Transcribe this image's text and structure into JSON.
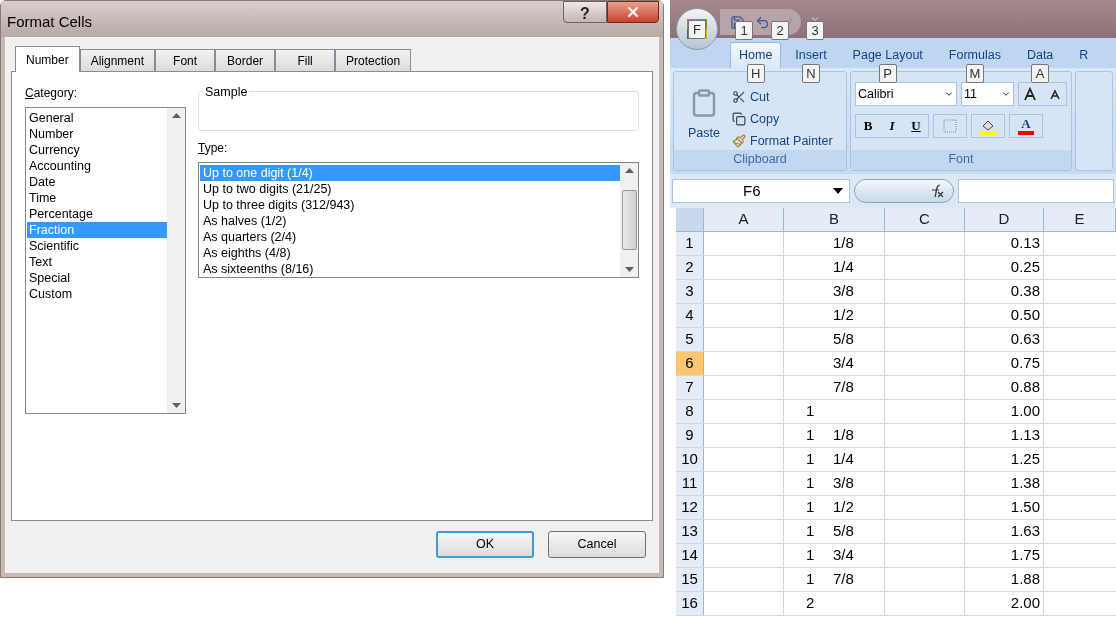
{
  "dialog": {
    "title": "Format Cells",
    "help": "?",
    "tabs": [
      {
        "label": "Number",
        "selected": true
      },
      {
        "label": "Alignment",
        "selected": false
      },
      {
        "label": "Font",
        "selected": false
      },
      {
        "label": "Border",
        "selected": false
      },
      {
        "label": "Fill",
        "selected": false
      },
      {
        "label": "Protection",
        "selected": false
      }
    ],
    "category_label": "Category:",
    "categories": [
      {
        "label": "General",
        "selected": false
      },
      {
        "label": "Number",
        "selected": false
      },
      {
        "label": "Currency",
        "selected": false
      },
      {
        "label": "Accounting",
        "selected": false
      },
      {
        "label": "Date",
        "selected": false
      },
      {
        "label": "Time",
        "selected": false
      },
      {
        "label": "Percentage",
        "selected": false
      },
      {
        "label": "Fraction",
        "selected": true
      },
      {
        "label": "Scientific",
        "selected": false
      },
      {
        "label": "Text",
        "selected": false
      },
      {
        "label": "Special",
        "selected": false
      },
      {
        "label": "Custom",
        "selected": false
      }
    ],
    "sample_label": "Sample",
    "type_label": "Type:",
    "types": [
      {
        "label": "Up to one digit (1/4)",
        "selected": true
      },
      {
        "label": "Up to two digits (21/25)",
        "selected": false
      },
      {
        "label": "Up to three digits (312/943)",
        "selected": false
      },
      {
        "label": "As halves (1/2)",
        "selected": false
      },
      {
        "label": "As quarters (2/4)",
        "selected": false
      },
      {
        "label": "As eighths (4/8)",
        "selected": false
      },
      {
        "label": "As sixteenths (8/16)",
        "selected": false
      }
    ],
    "buttons": [
      {
        "label": "OK",
        "default": true
      },
      {
        "label": "Cancel",
        "default": false
      }
    ]
  },
  "excel": {
    "office_keytip": "F",
    "quick_access_keytips": [
      "1",
      "2",
      "3"
    ],
    "ribbon_tabs": [
      {
        "label": "Home",
        "selected": true,
        "keytip": "H"
      },
      {
        "label": "Insert",
        "selected": false,
        "keytip": "N"
      },
      {
        "label": "Page Layout",
        "selected": false,
        "keytip": "P"
      },
      {
        "label": "Formulas",
        "selected": false,
        "keytip": "M"
      },
      {
        "label": "Data",
        "selected": false,
        "keytip": "A"
      },
      {
        "label": "R",
        "selected": false
      }
    ],
    "clipboard": {
      "paste": "Paste",
      "cut": "Cut",
      "copy": "Copy",
      "format_painter": "Format Painter",
      "label": "Clipboard"
    },
    "font": {
      "name": "Calibri",
      "size": "11",
      "bold": "B",
      "italic": "I",
      "underline": "U",
      "font_color": "A",
      "label": "Font"
    },
    "name_box": "F6",
    "columns": [
      "A",
      "B",
      "C",
      "D",
      "E"
    ],
    "rows": [
      {
        "number": "1",
        "selected": false,
        "b": {
          "fraction": "1/8"
        },
        "d": "0.13"
      },
      {
        "number": "2",
        "selected": false,
        "b": {
          "fraction": "1/4"
        },
        "d": "0.25"
      },
      {
        "number": "3",
        "selected": false,
        "b": {
          "fraction": "3/8"
        },
        "d": "0.38"
      },
      {
        "number": "4",
        "selected": false,
        "b": {
          "fraction": "1/2"
        },
        "d": "0.50"
      },
      {
        "number": "5",
        "selected": false,
        "b": {
          "fraction": "5/8"
        },
        "d": "0.63"
      },
      {
        "number": "6",
        "selected": true,
        "b": {
          "fraction": "3/4"
        },
        "d": "0.75"
      },
      {
        "number": "7",
        "selected": false,
        "b": {
          "fraction": "7/8"
        },
        "d": "0.88"
      },
      {
        "number": "8",
        "selected": false,
        "b": {
          "whole": "1"
        },
        "d": "1.00"
      },
      {
        "number": "9",
        "selected": false,
        "b": {
          "whole": "1",
          "fraction": "1/8"
        },
        "d": "1.13"
      },
      {
        "number": "10",
        "selected": false,
        "b": {
          "whole": "1",
          "fraction": "1/4"
        },
        "d": "1.25"
      },
      {
        "number": "11",
        "selected": false,
        "b": {
          "whole": "1",
          "fraction": "3/8"
        },
        "d": "1.38"
      },
      {
        "number": "12",
        "selected": false,
        "b": {
          "whole": "1",
          "fraction": "1/2"
        },
        "d": "1.50"
      },
      {
        "number": "13",
        "selected": false,
        "b": {
          "whole": "1",
          "fraction": "5/8"
        },
        "d": "1.63"
      },
      {
        "number": "14",
        "selected": false,
        "b": {
          "whole": "1",
          "fraction": "3/4"
        },
        "d": "1.75"
      },
      {
        "number": "15",
        "selected": false,
        "b": {
          "whole": "1",
          "fraction": "7/8"
        },
        "d": "1.88"
      },
      {
        "number": "16",
        "selected": false,
        "b": {
          "whole": "2"
        },
        "d": "2.00"
      }
    ]
  }
}
